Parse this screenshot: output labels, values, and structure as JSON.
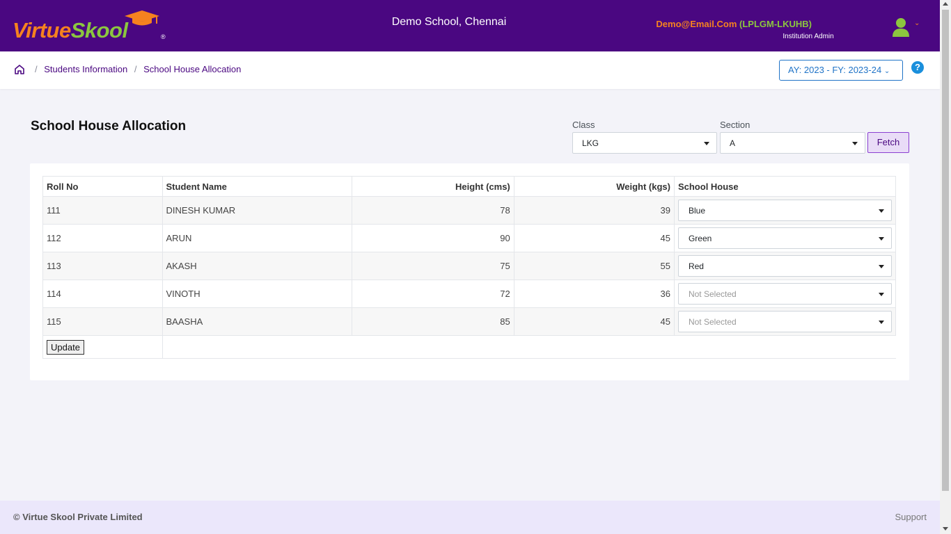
{
  "header": {
    "logo": {
      "part1": "Virtue",
      "part2": "Skool",
      "reg": "®"
    },
    "school_name": "Demo School, Chennai",
    "user_email": "Demo@Email.Com",
    "user_code": "(LPLGM-LKUHB)",
    "user_role": "Institution Admin",
    "avatar_icon": "user-icon"
  },
  "breadcrumb": {
    "home_icon": "home-icon",
    "items": [
      "Students Information",
      "School House Allocation"
    ]
  },
  "academic_year": {
    "label": "AY: 2023 - FY: 2023-24"
  },
  "help": {
    "label": "?"
  },
  "page": {
    "title": "School House Allocation"
  },
  "filters": {
    "class_label": "Class",
    "class_value": "LKG",
    "section_label": "Section",
    "section_value": "A",
    "fetch_label": "Fetch"
  },
  "table": {
    "columns": [
      "Roll No",
      "Student Name",
      "Height (cms)",
      "Weight (kgs)",
      "School House"
    ],
    "rows": [
      {
        "roll": "111",
        "name": "DINESH KUMAR",
        "height": "78",
        "weight": "39",
        "house": "Blue"
      },
      {
        "roll": "112",
        "name": "ARUN",
        "height": "90",
        "weight": "45",
        "house": "Green"
      },
      {
        "roll": "113",
        "name": "AKASH",
        "height": "75",
        "weight": "55",
        "house": "Red"
      },
      {
        "roll": "114",
        "name": "VINOTH",
        "height": "72",
        "weight": "36",
        "house": "Not Selected"
      },
      {
        "roll": "115",
        "name": "BAASHA",
        "height": "85",
        "weight": "45",
        "house": "Not Selected"
      }
    ],
    "update_label": "Update"
  },
  "footer": {
    "copyright": "© Virtue Skool Private Limited",
    "support": "Support"
  },
  "colors": {
    "header_bg": "#4a0781",
    "brand_orange": "#f6821f",
    "brand_green": "#8cc63f",
    "link_blue": "#1f73c7",
    "footer_bg": "#ebe7fb"
  }
}
